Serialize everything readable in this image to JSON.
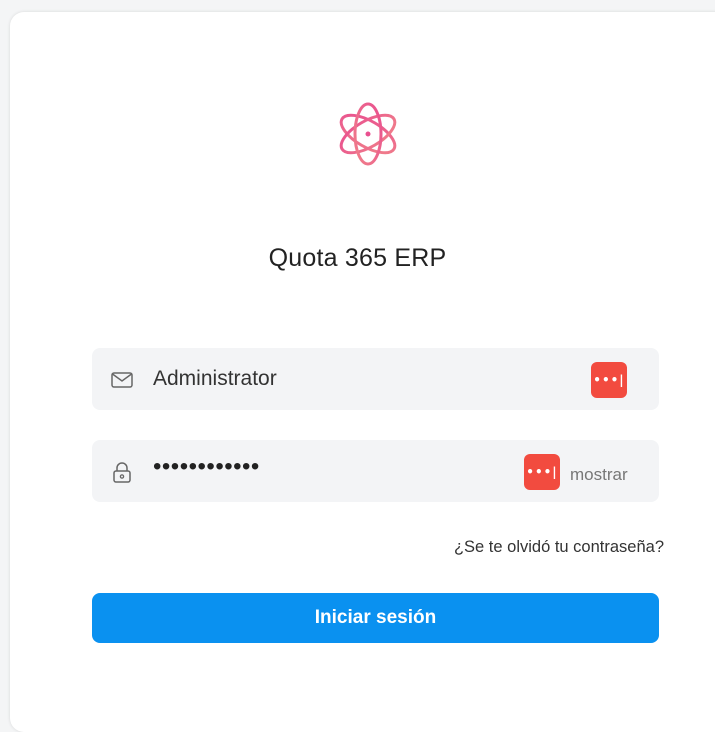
{
  "app": {
    "title": "Quota 365 ERP"
  },
  "login": {
    "email_value": "Administrator",
    "password_masked": "••••••••••••",
    "show_password_label": "mostrar",
    "forgot_password_label": "¿Se te olvidó tu contraseña?",
    "submit_label": "Iniciar sesión"
  },
  "password_manager": {
    "badge_text": "•••|"
  },
  "icons": {
    "logo": "atom-flower-logo",
    "email_field": "envelope-icon",
    "password_field": "lock-icon",
    "password_manager": "password-manager-icon"
  },
  "colors": {
    "primary_button": "#0a91f0",
    "logo_gradient_start": "#e9508f",
    "logo_gradient_end": "#f07f8a",
    "password_manager_badge": "#f24b3f",
    "input_background": "#f3f4f6"
  }
}
